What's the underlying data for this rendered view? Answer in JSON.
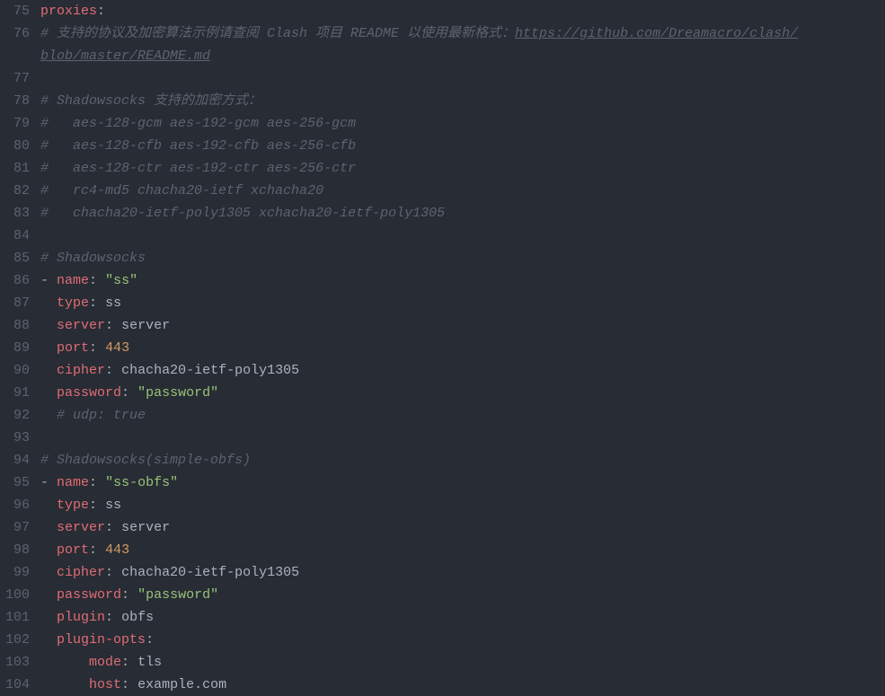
{
  "startLine": 75,
  "lines": [
    {
      "n": 75,
      "indent": 0,
      "spans": [
        {
          "cls": "tok-key",
          "t": "proxies"
        },
        {
          "cls": "tok-punct",
          "t": ":"
        }
      ]
    },
    {
      "n": 76,
      "indent": 0,
      "spans": [
        {
          "cls": "tok-comment",
          "t": "# 支持的协议及加密算法示例请查阅 Clash 项目 README 以使用最新格式："
        },
        {
          "cls": "tok-link",
          "t": "https://github.com/Dreamacro/clash/"
        }
      ]
    },
    {
      "n": "",
      "cont": true,
      "indent": 0,
      "spans": [
        {
          "cls": "tok-link",
          "t": "blob/master/README.md"
        }
      ]
    },
    {
      "n": 77,
      "indent": 0,
      "spans": []
    },
    {
      "n": 78,
      "indent": 0,
      "spans": [
        {
          "cls": "tok-comment",
          "t": "# Shadowsocks 支持的加密方式："
        }
      ]
    },
    {
      "n": 79,
      "indent": 0,
      "spans": [
        {
          "cls": "tok-comment",
          "t": "#   aes-128-gcm aes-192-gcm aes-256-gcm"
        }
      ]
    },
    {
      "n": 80,
      "indent": 0,
      "spans": [
        {
          "cls": "tok-comment",
          "t": "#   aes-128-cfb aes-192-cfb aes-256-cfb"
        }
      ]
    },
    {
      "n": 81,
      "indent": 0,
      "spans": [
        {
          "cls": "tok-comment",
          "t": "#   aes-128-ctr aes-192-ctr aes-256-ctr"
        }
      ]
    },
    {
      "n": 82,
      "indent": 0,
      "spans": [
        {
          "cls": "tok-comment",
          "t": "#   rc4-md5 chacha20-ietf xchacha20"
        }
      ]
    },
    {
      "n": 83,
      "indent": 0,
      "spans": [
        {
          "cls": "tok-comment",
          "t": "#   chacha20-ietf-poly1305 xchacha20-ietf-poly1305"
        }
      ]
    },
    {
      "n": 84,
      "indent": 0,
      "spans": []
    },
    {
      "n": 85,
      "indent": 0,
      "spans": [
        {
          "cls": "tok-comment",
          "t": "# Shadowsocks"
        }
      ]
    },
    {
      "n": 86,
      "indent": 0,
      "spans": [
        {
          "cls": "tok-punct",
          "t": "- "
        },
        {
          "cls": "tok-key",
          "t": "name"
        },
        {
          "cls": "tok-punct",
          "t": ": "
        },
        {
          "cls": "tok-string",
          "t": "\"ss\""
        }
      ]
    },
    {
      "n": 87,
      "indent": 2,
      "spans": [
        {
          "cls": "tok-key",
          "t": "type"
        },
        {
          "cls": "tok-punct",
          "t": ": "
        },
        {
          "cls": "tok-plain",
          "t": "ss"
        }
      ]
    },
    {
      "n": 88,
      "indent": 2,
      "spans": [
        {
          "cls": "tok-key",
          "t": "server"
        },
        {
          "cls": "tok-punct",
          "t": ": "
        },
        {
          "cls": "tok-plain",
          "t": "server"
        }
      ]
    },
    {
      "n": 89,
      "indent": 2,
      "spans": [
        {
          "cls": "tok-key",
          "t": "port"
        },
        {
          "cls": "tok-punct",
          "t": ": "
        },
        {
          "cls": "tok-num",
          "t": "443"
        }
      ]
    },
    {
      "n": 90,
      "indent": 2,
      "spans": [
        {
          "cls": "tok-key",
          "t": "cipher"
        },
        {
          "cls": "tok-punct",
          "t": ": "
        },
        {
          "cls": "tok-plain",
          "t": "chacha20-ietf-poly1305"
        }
      ]
    },
    {
      "n": 91,
      "indent": 2,
      "spans": [
        {
          "cls": "tok-key",
          "t": "password"
        },
        {
          "cls": "tok-punct",
          "t": ": "
        },
        {
          "cls": "tok-string",
          "t": "\"password\""
        }
      ]
    },
    {
      "n": 92,
      "indent": 2,
      "spans": [
        {
          "cls": "tok-comment",
          "t": "# udp: true"
        }
      ]
    },
    {
      "n": 93,
      "indent": 0,
      "spans": []
    },
    {
      "n": 94,
      "indent": 0,
      "spans": [
        {
          "cls": "tok-comment",
          "t": "# Shadowsocks(simple-obfs)"
        }
      ]
    },
    {
      "n": 95,
      "indent": 0,
      "spans": [
        {
          "cls": "tok-punct",
          "t": "- "
        },
        {
          "cls": "tok-key",
          "t": "name"
        },
        {
          "cls": "tok-punct",
          "t": ": "
        },
        {
          "cls": "tok-string",
          "t": "\"ss-obfs\""
        }
      ]
    },
    {
      "n": 96,
      "indent": 2,
      "spans": [
        {
          "cls": "tok-key",
          "t": "type"
        },
        {
          "cls": "tok-punct",
          "t": ": "
        },
        {
          "cls": "tok-plain",
          "t": "ss"
        }
      ]
    },
    {
      "n": 97,
      "indent": 2,
      "spans": [
        {
          "cls": "tok-key",
          "t": "server"
        },
        {
          "cls": "tok-punct",
          "t": ": "
        },
        {
          "cls": "tok-plain",
          "t": "server"
        }
      ]
    },
    {
      "n": 98,
      "indent": 2,
      "spans": [
        {
          "cls": "tok-key",
          "t": "port"
        },
        {
          "cls": "tok-punct",
          "t": ": "
        },
        {
          "cls": "tok-num",
          "t": "443"
        }
      ]
    },
    {
      "n": 99,
      "indent": 2,
      "spans": [
        {
          "cls": "tok-key",
          "t": "cipher"
        },
        {
          "cls": "tok-punct",
          "t": ": "
        },
        {
          "cls": "tok-plain",
          "t": "chacha20-ietf-poly1305"
        }
      ]
    },
    {
      "n": 100,
      "indent": 2,
      "spans": [
        {
          "cls": "tok-key",
          "t": "password"
        },
        {
          "cls": "tok-punct",
          "t": ": "
        },
        {
          "cls": "tok-string",
          "t": "\"password\""
        }
      ]
    },
    {
      "n": 101,
      "indent": 2,
      "spans": [
        {
          "cls": "tok-key",
          "t": "plugin"
        },
        {
          "cls": "tok-punct",
          "t": ": "
        },
        {
          "cls": "tok-plain",
          "t": "obfs"
        }
      ]
    },
    {
      "n": 102,
      "indent": 2,
      "spans": [
        {
          "cls": "tok-key",
          "t": "plugin-opts"
        },
        {
          "cls": "tok-punct",
          "t": ":"
        }
      ]
    },
    {
      "n": 103,
      "indent": 6,
      "spans": [
        {
          "cls": "tok-key",
          "t": "mode"
        },
        {
          "cls": "tok-punct",
          "t": ": "
        },
        {
          "cls": "tok-plain",
          "t": "tls"
        }
      ]
    },
    {
      "n": 104,
      "indent": 6,
      "spans": [
        {
          "cls": "tok-key",
          "t": "host"
        },
        {
          "cls": "tok-punct",
          "t": ": "
        },
        {
          "cls": "tok-plain",
          "t": "example.com"
        }
      ]
    }
  ]
}
